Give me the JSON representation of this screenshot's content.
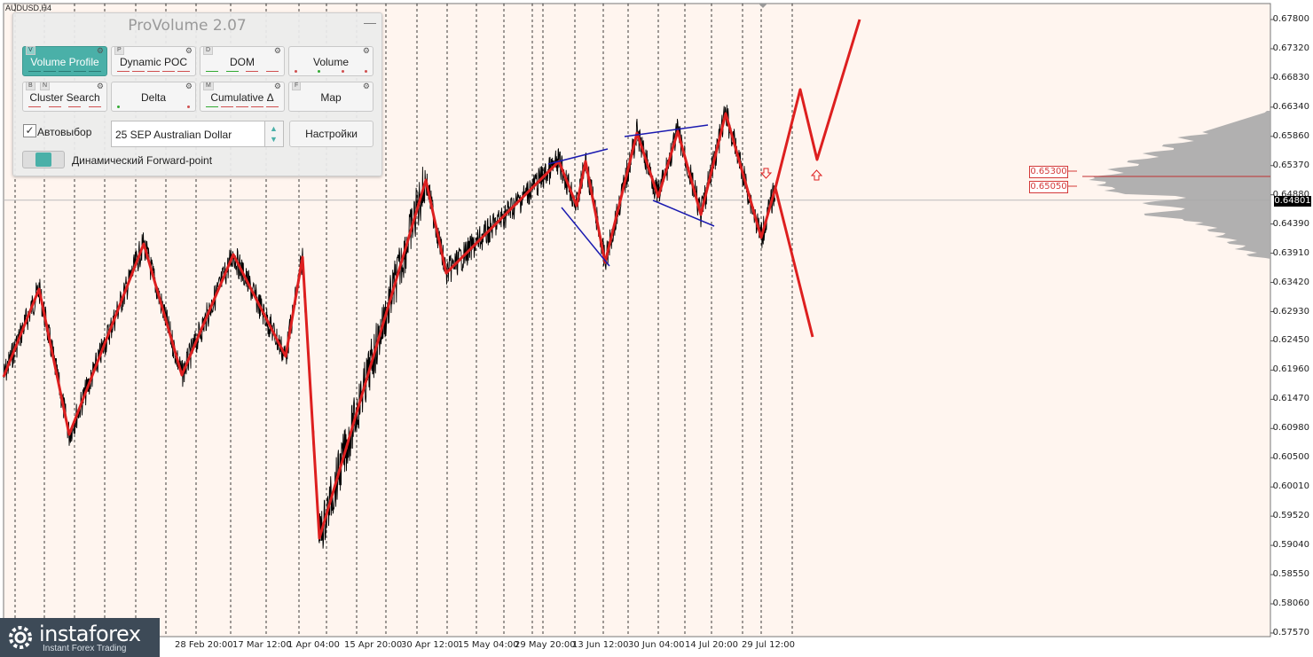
{
  "chart": {
    "symbol": "AUDUSD,H4",
    "price_levels": [
      "0.67800",
      "0.67320",
      "0.66830",
      "0.66340",
      "0.65860",
      "0.65370",
      "0.64880",
      "0.64390",
      "0.63910",
      "0.63420",
      "0.62930",
      "0.62450",
      "0.61960",
      "0.61470",
      "0.60980",
      "0.60500",
      "0.60010",
      "0.59520",
      "0.59040",
      "0.58550",
      "0.58060",
      "0.57570"
    ],
    "current_price": "0.64801",
    "level_1": "0.65300",
    "level_2": "0.65050",
    "time_labels": [
      "28 Feb 20:00",
      "17 Mar 12:00",
      "1 Apr 04:00",
      "15 Apr 20:00",
      "30 Apr 12:00",
      "15 May 04:00",
      "29 May 20:00",
      "13 Jun 12:00",
      "30 Jun 04:00",
      "14 Jul 20:00",
      "29 Jul 12:00"
    ],
    "colors": {
      "background": "#fff5ef",
      "price": "#000000",
      "zigzag": "#dd1f1f",
      "channel": "#1a1ab0",
      "profile": "#a9a9a9",
      "grid": "#000000"
    }
  },
  "provolume": {
    "title": "ProVolume 2.07",
    "minimize_icon": "minimize-icon",
    "buttons": [
      {
        "label": "Volume Profile",
        "key": "V",
        "active": true
      },
      {
        "label": "Dynamic POC",
        "key": "P",
        "active": false
      },
      {
        "label": "DOM",
        "key": "D",
        "active": false
      },
      {
        "label": "Volume",
        "key": "",
        "active": false
      },
      {
        "label": "Cluster Search",
        "key": "B",
        "key2": "N",
        "active": false
      },
      {
        "label": "Delta",
        "key": "",
        "active": false
      },
      {
        "label": "Cumulative Δ",
        "key": "M",
        "active": false
      },
      {
        "label": "Map",
        "key": "F",
        "active": false
      }
    ],
    "auto_select_label": "Автовыбор",
    "auto_select_checked": true,
    "instrument_value": "25 SEP Australian Dollar",
    "settings_label": "Настройки",
    "forward_point_label": "Динамический Forward-point"
  },
  "logo": {
    "name": "instaforex",
    "tagline": "Instant Forex Trading"
  }
}
